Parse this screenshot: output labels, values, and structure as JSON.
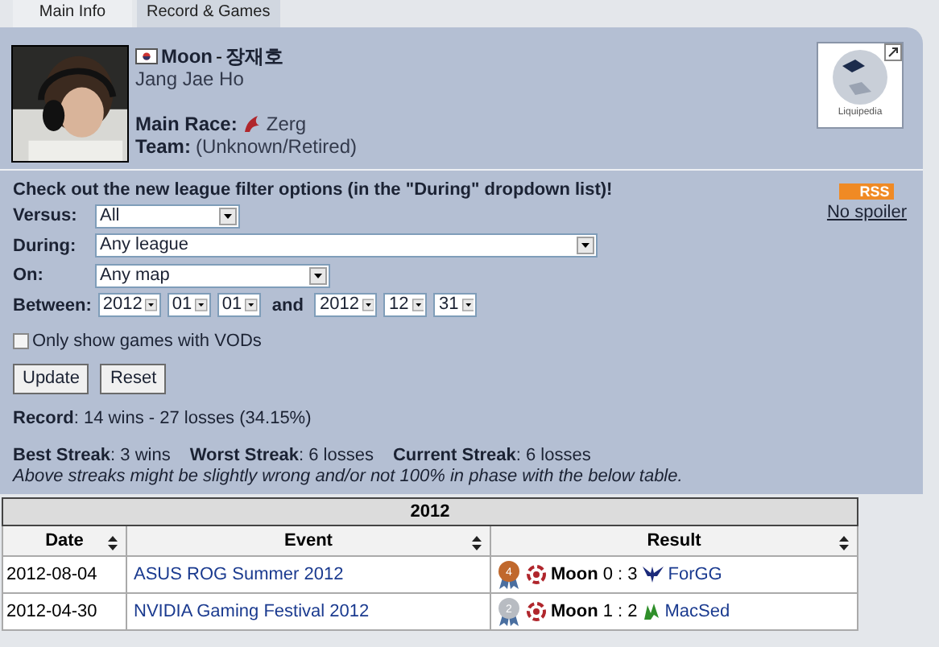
{
  "tabs": [
    {
      "label": "Main Info",
      "selected": false
    },
    {
      "label": "Record & Games",
      "selected": true
    }
  ],
  "player": {
    "name": "Moon",
    "separator": "-",
    "native_name": "장재호",
    "real_name": "Jang Jae Ho",
    "race_label": "Main Race:",
    "race_icon": {
      "kind": "zerg"
    },
    "race_name": "Zerg",
    "team_label": "Team:",
    "team": "(Unknown/Retired)",
    "wiki_label": "Liquipedia"
  },
  "filters": {
    "notice": "Check out the new league filter options (in the \"During\" dropdown list)!",
    "rss": "RSS",
    "no_spoiler": "No spoiler",
    "versus": {
      "label": "Versus:",
      "value": "All"
    },
    "during": {
      "label": "During:",
      "value": "Any league"
    },
    "on": {
      "label": "On:",
      "value": "Any map"
    },
    "between": {
      "label": "Between:",
      "from": [
        "2012",
        "01",
        "01"
      ],
      "and": "and",
      "to": [
        "2012",
        "12",
        "31"
      ]
    },
    "vods": {
      "label": "Only show games with VODs",
      "checked": false
    },
    "buttons": [
      "Update",
      "Reset"
    ]
  },
  "stats": {
    "record_label": "Record",
    "record": ": 14 wins - 27 losses (34.15%)",
    "best_label": "Best Streak",
    "best": ": 3 wins",
    "worst_label": "Worst Streak",
    "worst": ": 6 losses",
    "current_label": "Current Streak",
    "current": ": 6 losses",
    "note": "Above streaks might be slightly wrong and/or not 100% in phase with the below table."
  },
  "table": {
    "title": "2012",
    "columns": [
      "Date",
      "Event",
      "Result"
    ],
    "rows": [
      {
        "date": "2012-08-04",
        "event": "ASUS ROG Summer 2012",
        "medal": {
          "color": "#c0682c",
          "place": "4"
        },
        "race_icon": {
          "kind": "zerg"
        },
        "player": "Moon",
        "score": "0 : 3",
        "opponent_icon": {
          "kind": "protoss"
        },
        "opponent": "ForGG"
      },
      {
        "date": "2012-04-30",
        "event": "NVIDIA Gaming Festival 2012",
        "medal": {
          "color": "#b8bcc2",
          "place": "2"
        },
        "race_icon": {
          "kind": "zerg"
        },
        "player": "Moon",
        "score": "1 : 2",
        "opponent_icon": {
          "kind": "terran"
        },
        "opponent": "MacSed"
      }
    ]
  }
}
